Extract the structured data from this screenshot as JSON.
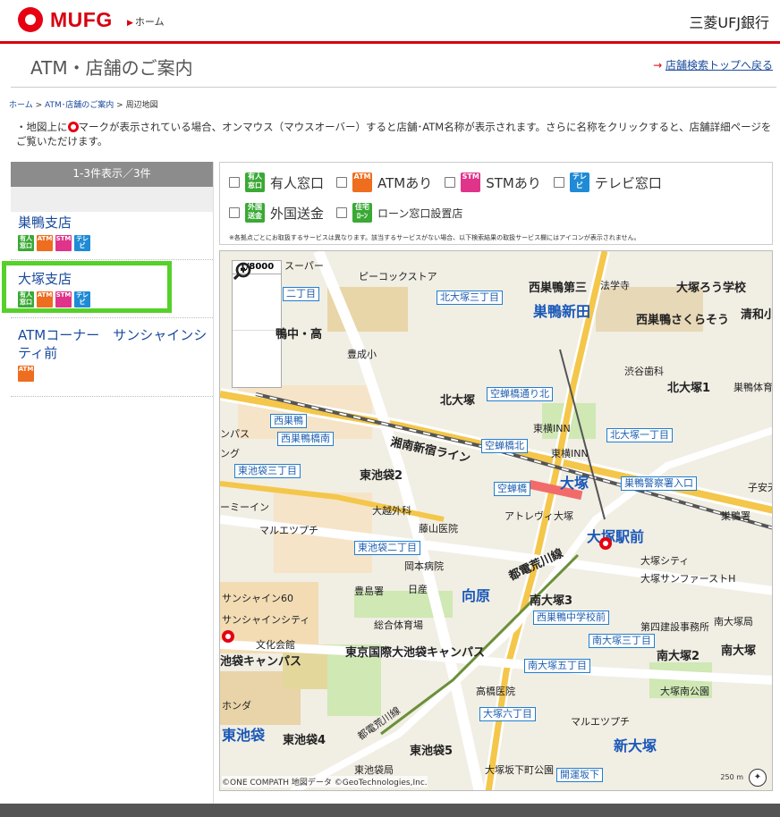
{
  "header": {
    "logo_text": "MUFG",
    "home_link": "ホーム",
    "bank_name": "三菱UFJ銀行"
  },
  "page": {
    "title": "ATM・店舗のご案内",
    "top_link": "店舗検索トップへ戻る"
  },
  "breadcrumb": {
    "home": "ホーム",
    "atm": "ATM･店舗のご案内",
    "current": "周辺地図",
    "sep": ">"
  },
  "note": {
    "before": "・地図上に",
    "after": "マークが表示されている場合、オンマウス（マウスオーバー）すると店舗･ATM名称が表示されます。さらに名称をクリックすると、店舗詳細ページをご覧いただけます。"
  },
  "sidebar": {
    "count": "1-3件表示／3件",
    "items": [
      {
        "name": "巣鴨支店",
        "icons": [
          "有人窓口",
          "ATM",
          "STM",
          "テレビ"
        ]
      },
      {
        "name": "大塚支店",
        "icons": [
          "有人窓口",
          "ATM",
          "STM",
          "テレビ"
        ]
      },
      {
        "name": "ATMコーナー　サンシャインシティ前",
        "icons": [
          "ATM"
        ]
      }
    ]
  },
  "filters": {
    "row1": [
      "有人窓口",
      "ATMあり",
      "STMあり",
      "テレビ窓口"
    ],
    "row2": [
      "外国送金",
      "ローン窓口設置店"
    ],
    "icon_text": {
      "manned": "有人\n窓口",
      "atm": "ATM",
      "stm": "STM",
      "tv": "テレビ",
      "forex": "外国\n送金",
      "loan": "住宅\nローン"
    },
    "footnote": "※各拠点ごとにお取扱するサービスは異なります。該当するサービスがない場合、以下検索結果の取扱サービス欄にはアイコンが表示されません。"
  },
  "map": {
    "scale": "1/8000",
    "zoom_in_icon": "zoom-in-icon",
    "zoom_out_icon": "zoom-out-icon",
    "labels": {
      "l1": "スーパー",
      "l2": "ピーコックストア",
      "l3": "西巣鴨第三",
      "l4": "法学寺",
      "l5": "大塚ろう学校",
      "l6": "巣鴨新田",
      "l7": "西巣鴨さくらそう",
      "l8": "清和小",
      "l9": "豊成小",
      "l10": "渋谷歯科",
      "l11": "北大塚1",
      "l12": "巣鴨体育",
      "l13": "北大塚",
      "l14": "東横INN",
      "l15": "東横INN",
      "l16": "湘南新宿ライン",
      "l17": "東池袋2",
      "l18": "大塚",
      "l19": "子安天",
      "l20": "大越外科",
      "l21": "アトレヴィ大塚",
      "l22": "巣鴨署",
      "l23": "藤山医院",
      "l24": "大塚駅前",
      "l25": "マルエツプチ",
      "l26": "大塚シティ",
      "l27": "大塚サンファーストH",
      "l28": "岡本病院",
      "l29": "都電荒川線",
      "l30": "豊島署",
      "l31": "日産",
      "l32": "向原",
      "l33": "南大塚3",
      "l34": "サンシャイン60",
      "l35": "サンシャインシティ",
      "l36": "総合体育場",
      "l37": "第四建設事務所",
      "l38": "南大塚局",
      "l39": "文化会館",
      "l40": "東京国際大池袋キャンパス",
      "l41": "南大塚2",
      "l42": "南大塚",
      "l43": "池袋キャンパス",
      "l44": "高橋医院",
      "l45": "大塚南公園",
      "l46": "ホンダ",
      "l47": "マルエツプチ",
      "l48": "東池袋",
      "l49": "東池袋4",
      "l50": "東池袋5",
      "l51": "新大塚",
      "l52": "東池袋局",
      "l53": "大塚坂下町公園",
      "l54": "都電荒川線",
      "l55": "鴨中・高",
      "l56": "ーミーイン",
      "l57": "ンパス",
      "l58": "ング"
    },
    "stations": {
      "s1": "二丁目",
      "s2": "北大塚三丁目",
      "s3": "空蝉橋通り北",
      "s4": "西巣鴨",
      "s5": "西巣鴨橋南",
      "s6": "北大塚一丁目",
      "s7": "空蝉橋北",
      "s8": "東池袋三丁目",
      "s9": "空蝉橋",
      "s10": "巣鴨警察署入口",
      "s11": "東池袋二丁目",
      "s12": "西巣鴨中学校前",
      "s13": "南大塚三丁目",
      "s14": "南大塚五丁目",
      "s15": "大塚六丁目",
      "s16": "開運坂下"
    },
    "attribution": "©ONE COMPATH 地図データ ©GeoTechnologies,Inc.",
    "scale_bar": "250 m",
    "mufg_label": "MUFG"
  },
  "colors": {
    "brand_red": "#d7000f",
    "highlight_green": "#56d02a",
    "link_blue": "#1a4a9c"
  }
}
